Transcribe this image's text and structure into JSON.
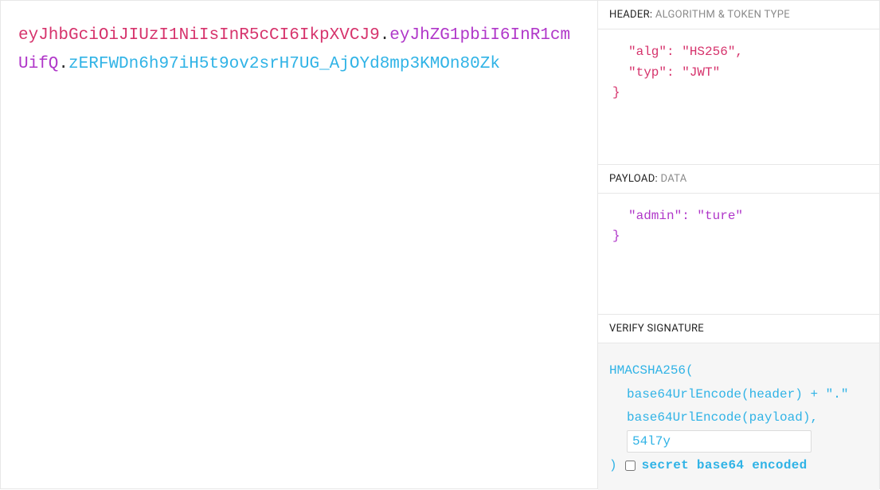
{
  "token": {
    "header_segment": "eyJhbGciOiJIUzI1NiIsInR5cCI6IkpXVCJ9",
    "payload_segment": "eyJhZG1pbiI6InR1cmUifQ",
    "signature_segment": "zERFWDn6h97iH5t9ov2srH7UG_AjOYd8mp3KMOn80Zk",
    "dot": "."
  },
  "sections": {
    "header": {
      "title": "HEADER:",
      "subtitle": " ALGORITHM & TOKEN TYPE",
      "line1": "\"alg\": \"HS256\",",
      "line2": "\"typ\": \"JWT\"",
      "close": "}"
    },
    "payload": {
      "title": "PAYLOAD:",
      "subtitle": " DATA",
      "line1": "\"admin\": \"ture\"",
      "close": "}"
    },
    "signature": {
      "title": "VERIFY SIGNATURE",
      "algo_open": "HMACSHA256(",
      "line_header": "base64UrlEncode(header) + \".\"",
      "line_payload": "base64UrlEncode(payload),",
      "secret_value": "54l7y",
      "close_paren": ")",
      "checkbox_label": "secret base64 encoded"
    }
  }
}
